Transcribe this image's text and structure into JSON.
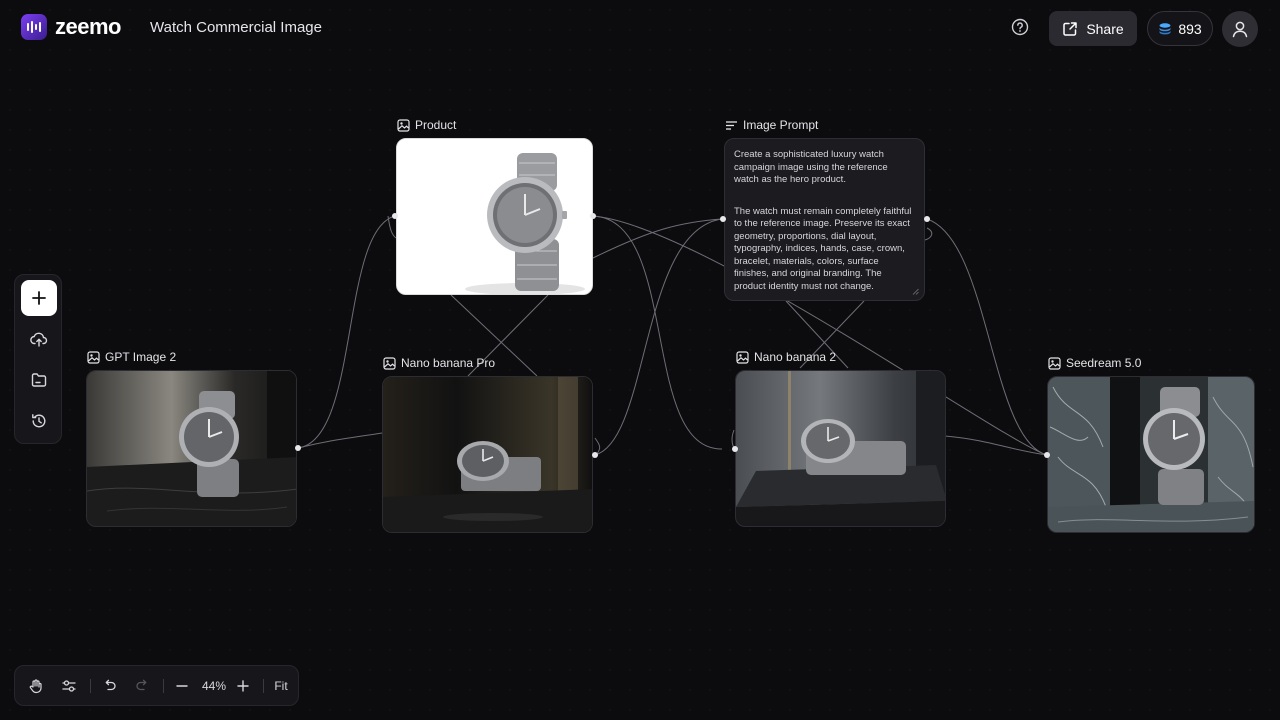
{
  "header": {
    "logo_text": "zeemo",
    "project_title": "Watch Commercial Image",
    "share_label": "Share",
    "credits": "893"
  },
  "toolbar": {
    "zoom": "44%",
    "fit_label": "Fit"
  },
  "nodes": {
    "product": {
      "label": "Product"
    },
    "image_prompt": {
      "label": "Image Prompt",
      "paragraph_1": "Create a sophisticated luxury watch campaign image using the reference watch as the hero product.",
      "paragraph_2": "The watch must remain completely faithful to the reference image. Preserve its exact geometry, proportions, dial layout, typography, indices, hands, case, crown, bracelet, materials, colors, surface finishes, and original branding. The product identity must not change."
    },
    "gpt_image": {
      "label": "GPT Image 2"
    },
    "nano_pro": {
      "label": "Nano banana Pro"
    },
    "nano_2": {
      "label": "Nano banana 2"
    },
    "seedream": {
      "label": "Seedream 5.0"
    }
  },
  "colors": {
    "accent": "#7b3ff2",
    "background": "#0c0c0f",
    "panel": "#17171b",
    "credit_coin": "#4aa8ff"
  }
}
